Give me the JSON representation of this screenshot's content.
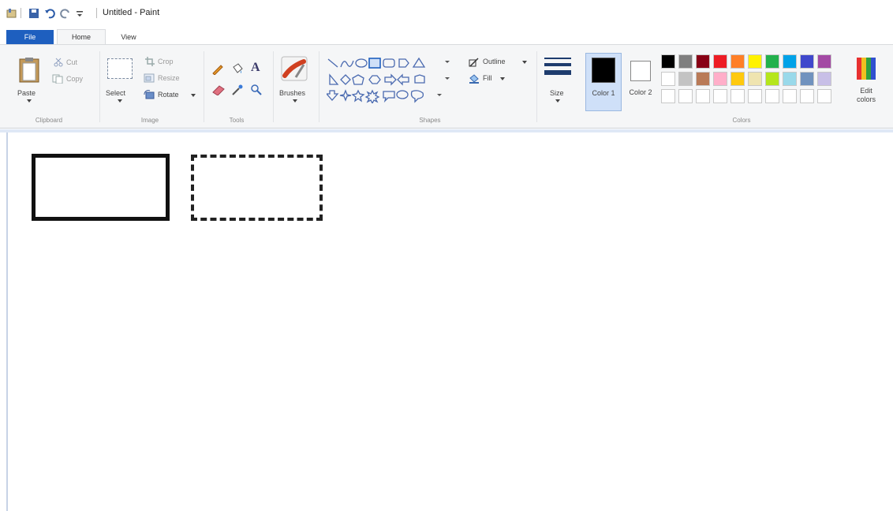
{
  "window": {
    "title": "Untitled - Paint"
  },
  "tabs": {
    "file": "File",
    "home": "Home",
    "view": "View"
  },
  "clipboard": {
    "paste": "Paste",
    "cut": "Cut",
    "copy": "Copy",
    "group": "Clipboard"
  },
  "image": {
    "select": "Select",
    "crop": "Crop",
    "resize": "Resize",
    "rotate": "Rotate",
    "group": "Image"
  },
  "tools": {
    "group": "Tools",
    "text": "A"
  },
  "brushes": {
    "label": "Brushes"
  },
  "shapes": {
    "outline": "Outline",
    "fill": "Fill",
    "group": "Shapes"
  },
  "size": {
    "label": "Size"
  },
  "colors": {
    "color1": "Color 1",
    "color2": "Color 2",
    "edit": "Edit colors",
    "group": "Colors",
    "color1_value": "#000000",
    "color2_value": "#ffffff",
    "palette_row1": [
      "#000000",
      "#7f7f7f",
      "#880015",
      "#ed1c24",
      "#ff7f27",
      "#fff200",
      "#22b14c",
      "#00a2e8",
      "#3f48cc",
      "#a349a4"
    ],
    "palette_row2": [
      "#ffffff",
      "#c3c3c3",
      "#b97a57",
      "#ffaec9",
      "#ffc90e",
      "#efe4b0",
      "#b5e61d",
      "#99d9ea",
      "#7092be",
      "#c8bfe7"
    ]
  }
}
